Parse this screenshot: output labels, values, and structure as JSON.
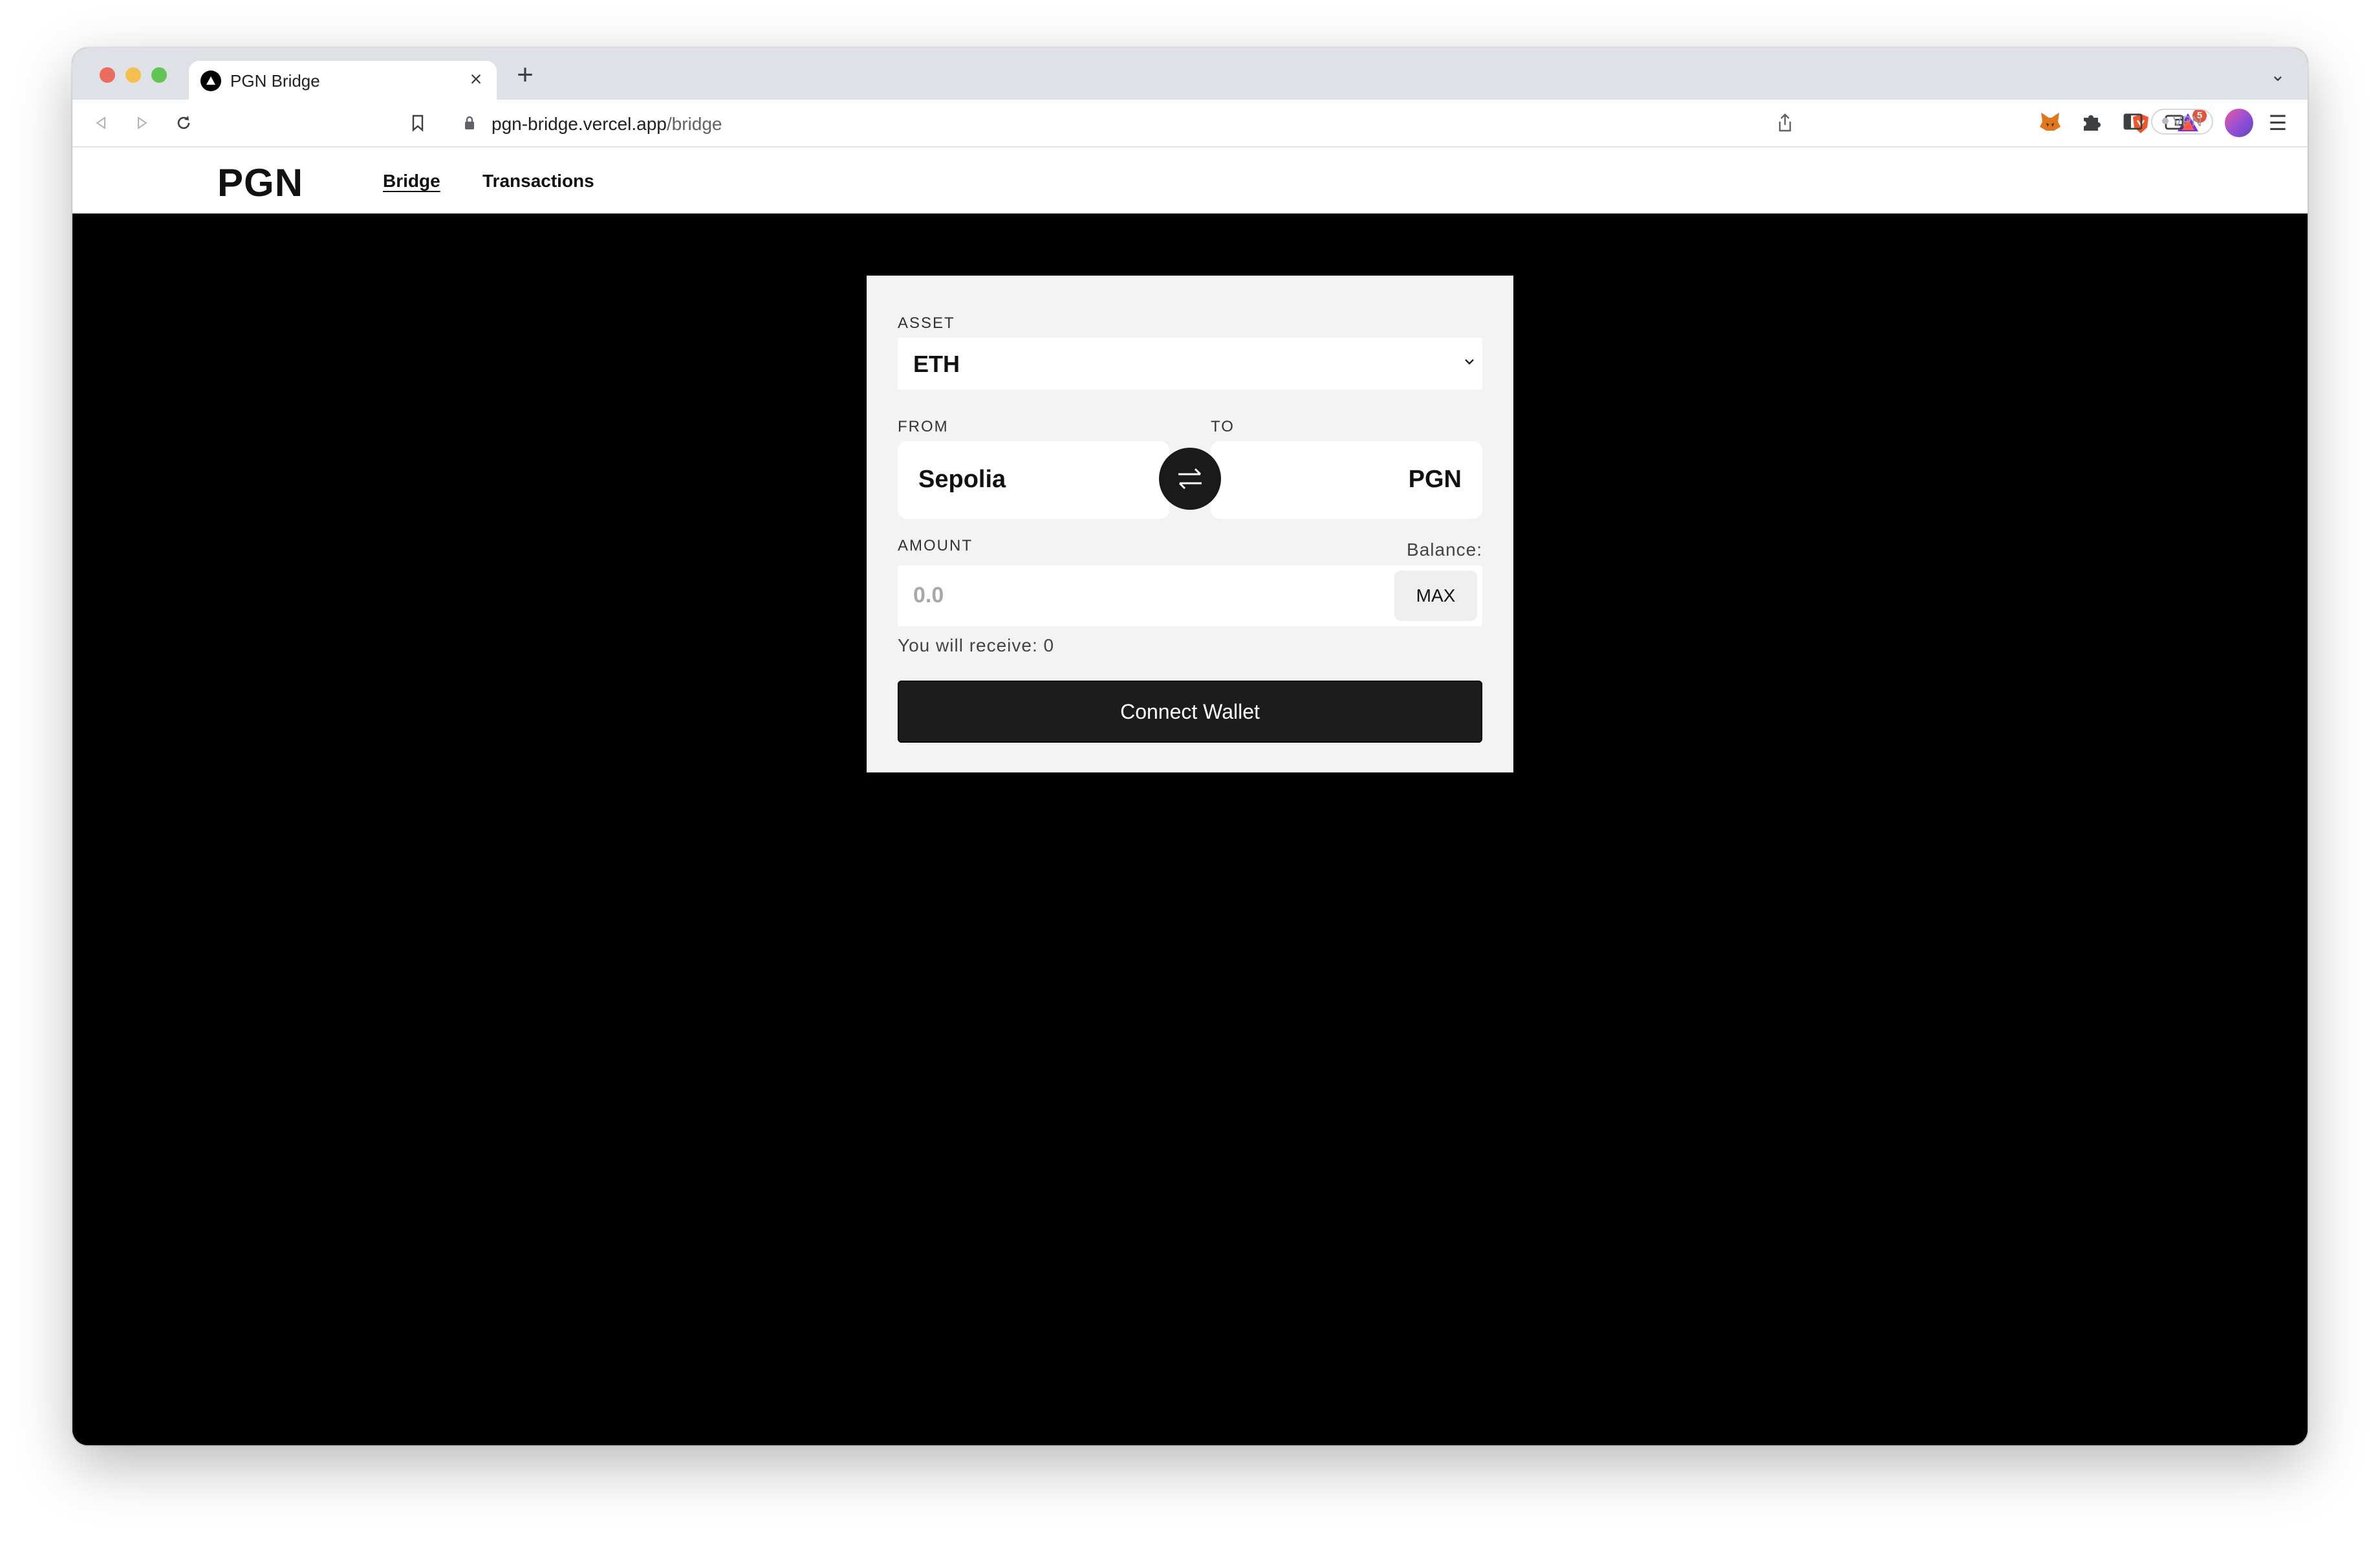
{
  "browser": {
    "tab_title": "PGN Bridge",
    "url_host": "pgn-bridge.vercel.app",
    "url_path": "/bridge",
    "rewards_badge": "5",
    "vpn_label": "VPN"
  },
  "site": {
    "logo": "PGN",
    "nav": {
      "bridge": "Bridge",
      "transactions": "Transactions"
    }
  },
  "bridge_form": {
    "asset_label": "ASSET",
    "asset_value": "ETH",
    "from_label": "FROM",
    "to_label": "TO",
    "from_chain": "Sepolia",
    "to_chain": "PGN",
    "amount_label": "AMOUNT",
    "balance_label": "Balance:",
    "amount_placeholder": "0.0",
    "max_label": "MAX",
    "receive_text": "You will receive: 0",
    "connect_label": "Connect Wallet"
  },
  "colors": {
    "page_background": "#000000",
    "card_background": "#f3f3f3",
    "button_dark": "#1c1c1c",
    "rewards_badge": "#e5523b"
  }
}
